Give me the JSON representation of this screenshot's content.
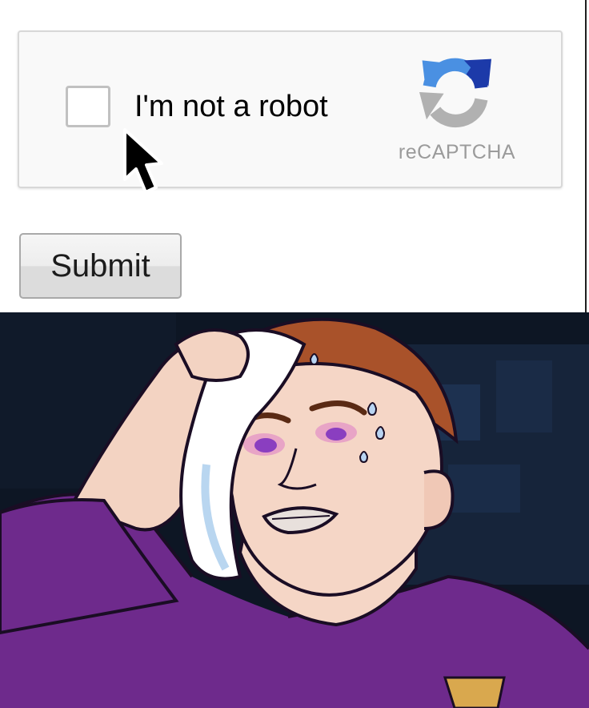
{
  "captcha": {
    "checkbox_checked": false,
    "label": "I'm not a robot",
    "brand": "reCAPTCHA",
    "logo_icon": "recaptcha-arrows-icon",
    "colors": {
      "logo_blue": "#4a90e2",
      "logo_dark_blue": "#1c3aa9",
      "logo_gray": "#b1b1b1",
      "box_background": "#f9f9f9",
      "box_border": "#d8d8d8"
    }
  },
  "cursor": {
    "icon": "mouse-pointer-arrow-icon"
  },
  "form": {
    "submit_label": "Submit"
  },
  "meme": {
    "icon": "sweating-cartoon-man-illustration",
    "colors": {
      "shirt_purple": "#6e2a8c",
      "background_dark": "#0d1624",
      "skin": "#f5d6c6",
      "hair": "#a9522a"
    }
  }
}
